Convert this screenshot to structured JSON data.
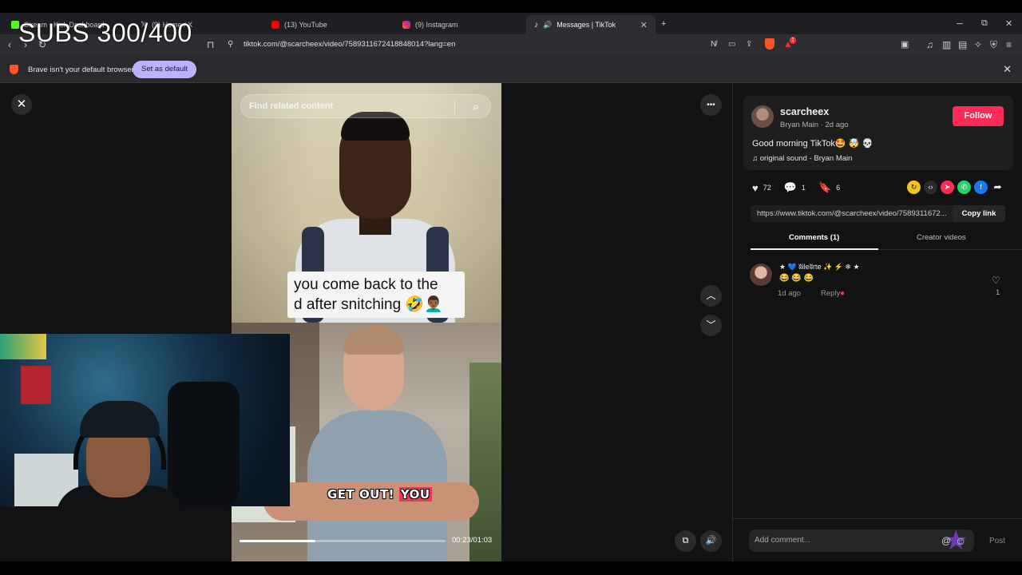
{
  "browser": {
    "tabs": [
      {
        "label": "Stream - Kick Dashboard",
        "color": "#53fc18"
      },
      {
        "label": "(9) Home / X",
        "color": "#ffffff"
      },
      {
        "label": "(13) YouTube",
        "color": "#ff0000"
      },
      {
        "label": "(9) Instagram",
        "color": "#dd2a7b"
      },
      {
        "label": "Messages | TikTok",
        "color": "#ffffff"
      }
    ],
    "new_tab_label": "+",
    "window_controls": {
      "minimize": "─",
      "restore": "⧉",
      "close": "✕"
    },
    "url": "tiktok.com/@scarcheex/video/7589311672418848014?lang=en",
    "shield_badge": "1",
    "infobar": {
      "message": "Brave isn't your default browser",
      "button": "Set as default",
      "close": "✕"
    }
  },
  "overlay": {
    "subs_text": "SUBS 300/400"
  },
  "video": {
    "search_placeholder": "Find related content",
    "caption_line1": "you come back to the",
    "caption_line2": "d after snitching 🤣👨🏾‍🦱",
    "subtitle_white": "GET OUT!",
    "subtitle_highlight": "YOU",
    "time": "00:23/01:03",
    "progress": 0.37
  },
  "controls": {
    "close": "✕",
    "more": "•••",
    "prev": "︿",
    "next": "﹀",
    "floating": "⧉",
    "volume": "🔊"
  },
  "post": {
    "username": "scarcheex",
    "display_name": "Bryan Main",
    "age": "2d ago",
    "follow": "Follow",
    "description": "Good morning TikTok🤩 🤯 💀",
    "sound": "original sound - Bryan Main",
    "likes": "72",
    "comments": "1",
    "saves": "6",
    "link": "https://www.tiktok.com/@scarcheex/video/7589311672...",
    "copy_link": "Copy link"
  },
  "tabs": {
    "comments": "Comments (1)",
    "creator_videos": "Creator videos"
  },
  "comment": {
    "author": "★ 💙 ʬileʬrte ✨ ⚡ ❄ ★",
    "text": "😂 😂 😂",
    "date": "1d ago",
    "reply": "Reply",
    "likes": "1"
  },
  "composer": {
    "placeholder": "Add comment...",
    "at": "@",
    "post": "Post"
  },
  "colors": {
    "accent": "#fe2c55",
    "background": "#121212",
    "infobar_button": "#b9b3ff"
  }
}
